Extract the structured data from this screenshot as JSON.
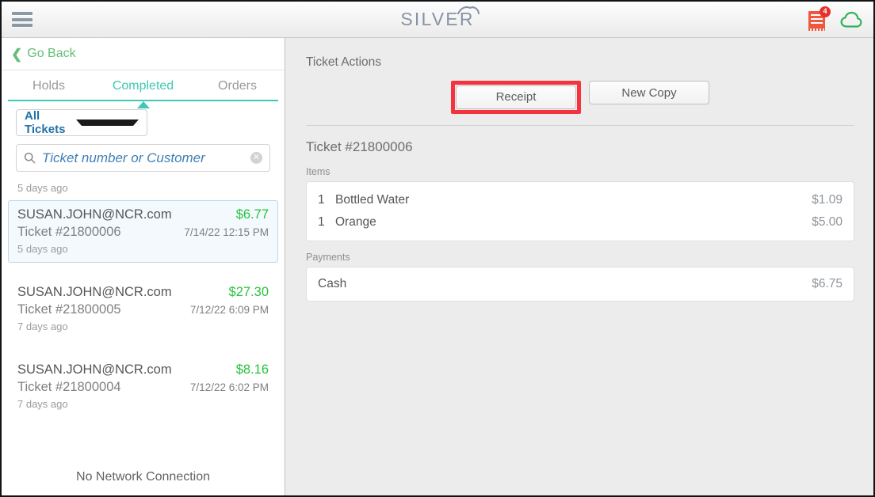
{
  "header": {
    "menu_icon": "hamburger-icon",
    "logo_text": "SILVER",
    "receipt_icon": "receipt-icon",
    "receipt_badge": "4",
    "cloud_icon": "cloud-icon",
    "badge_color": "#e8302c",
    "receipt_color": "#f0583e",
    "cloud_color": "#2fb457"
  },
  "sidebar": {
    "go_back_label": "Go Back",
    "go_back_color": "#63bf7a",
    "tabs": [
      {
        "label": "Holds",
        "active": false
      },
      {
        "label": "Completed",
        "active": true
      },
      {
        "label": "Orders",
        "active": false
      }
    ],
    "active_tab_color": "#3fc8b4",
    "filter": {
      "selected": "All Tickets",
      "caret_icon": "chevron-down-icon"
    },
    "search": {
      "icon": "search-icon",
      "placeholder": "Ticket number or Customer",
      "value": "",
      "clear_icon": "clear-circle-icon"
    },
    "group_label": "5 days ago",
    "tickets": [
      {
        "customer": "SUSAN.JOHN@NCR.com",
        "amount": "$6.77",
        "ticket": "Ticket #21800006",
        "datetime": "7/14/22 12:15 PM",
        "ago": "5 days ago",
        "selected": true
      },
      {
        "customer": "SUSAN.JOHN@NCR.com",
        "amount": "$27.30",
        "ticket": "Ticket #21800005",
        "datetime": "7/12/22 6:09 PM",
        "ago": "7 days ago",
        "selected": false
      },
      {
        "customer": "SUSAN.JOHN@NCR.com",
        "amount": "$8.16",
        "ticket": "Ticket #21800004",
        "datetime": "7/12/22 6:02 PM",
        "ago": "7 days ago",
        "selected": false
      }
    ],
    "status_text": "No Network Connection"
  },
  "main": {
    "actions_title": "Ticket Actions",
    "buttons": [
      {
        "label": "Receipt",
        "highlighted": true
      },
      {
        "label": "New Copy",
        "highlighted": false
      }
    ],
    "highlight_color": "#f5333f",
    "ticket_heading": "Ticket #21800006",
    "items_label": "Items",
    "items": [
      {
        "qty": "1",
        "name": "Bottled Water",
        "price": "$1.09"
      },
      {
        "qty": "1",
        "name": "Orange",
        "price": "$5.00"
      }
    ],
    "payments_label": "Payments",
    "payments": [
      {
        "name": "Cash",
        "price": "$6.75"
      }
    ]
  }
}
